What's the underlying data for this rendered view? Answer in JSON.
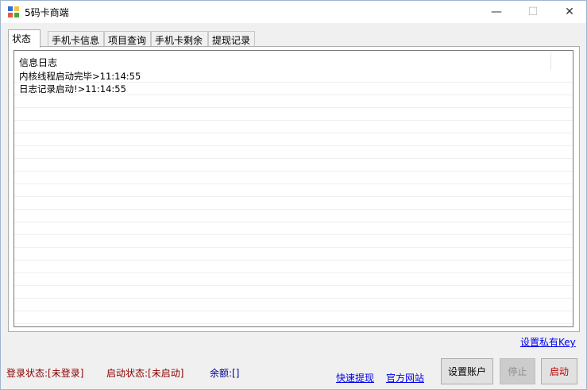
{
  "window": {
    "title": "5码卡商端",
    "minimize_glyph": "—",
    "maximize_glyph": "☐",
    "close_glyph": "✕",
    "app_icon": "app-grid-icon"
  },
  "tabs": [
    {
      "label": "状态",
      "active": true
    },
    {
      "label": "手机卡信息",
      "active": false
    },
    {
      "label": "项目查询",
      "active": false
    },
    {
      "label": "手机卡剩余",
      "active": false
    },
    {
      "label": "提现记录",
      "active": false
    }
  ],
  "log": {
    "header": "信息日志",
    "rows": [
      "内核线程启动完毕>11:14:55",
      "日志记录启动!>11:14:55"
    ]
  },
  "footer": {
    "private_key_link": "设置私有Key",
    "login_status": "登录状态:[未登录]",
    "start_status": "启动状态:[未启动]",
    "balance": "余额:[]",
    "quick_withdraw_link": "快速提现",
    "official_site_link": "官方网站",
    "set_account_button": "设置账户",
    "stop_button": "停止",
    "start_button": "启动"
  }
}
